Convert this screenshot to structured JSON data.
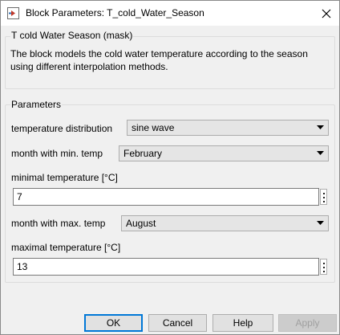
{
  "window": {
    "title": "Block Parameters: T_cold_Water_Season"
  },
  "mask": {
    "title": "T cold Water Season (mask)",
    "description": "The block models the cold water temperature according to the season using different interpolation methods."
  },
  "parameters": {
    "title": "Parameters",
    "distribution": {
      "label": "temperature distribution",
      "value": "sine wave"
    },
    "min_month": {
      "label": "month with min. temp",
      "value": "February"
    },
    "min_temp": {
      "label": "minimal temperature [°C]",
      "value": "7"
    },
    "max_month": {
      "label": "month with max. temp",
      "value": "August"
    },
    "max_temp": {
      "label": "maximal temperature [°C]",
      "value": "13"
    }
  },
  "buttons": {
    "ok": "OK",
    "cancel": "Cancel",
    "help": "Help",
    "apply": "Apply"
  }
}
